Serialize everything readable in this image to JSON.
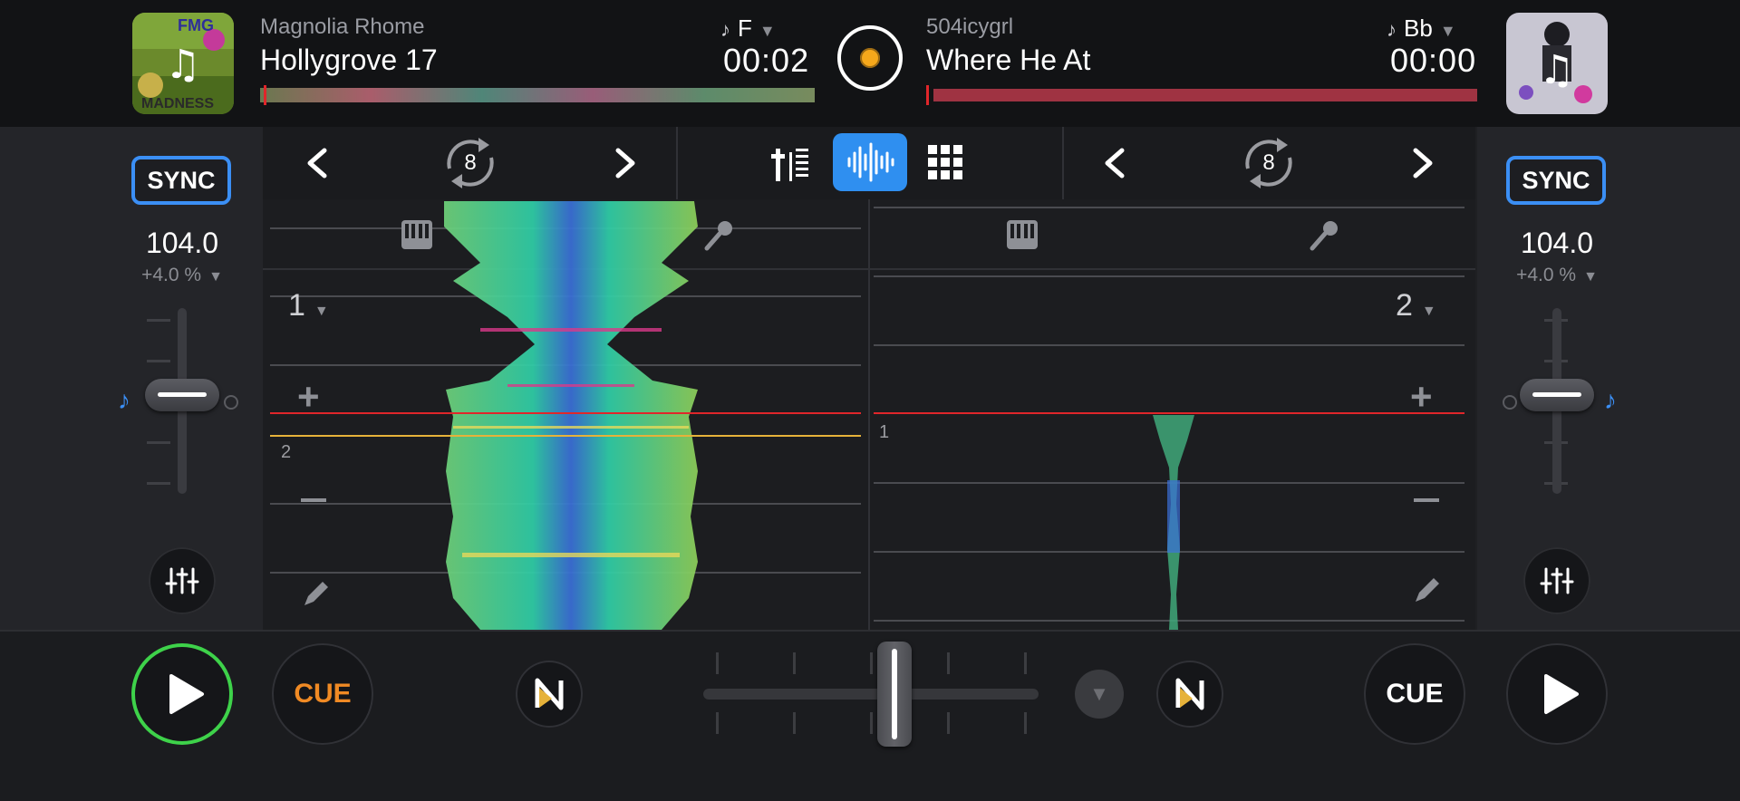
{
  "deck_left": {
    "artist": "Magnolia Rhome",
    "title": "Hollygrove 17",
    "time": "00:02",
    "key": "F",
    "bpm": "104.0",
    "pitch": "+4.0 %",
    "sync_label": "SYNC",
    "cue_label": "CUE",
    "loop_size": "8",
    "hotcue_bank": "1",
    "marker": "2",
    "colors": {
      "cue_text": "#f08a24",
      "play_ring": "#3ed24a"
    }
  },
  "deck_right": {
    "artist": "504icygrl",
    "title": "Where He At",
    "time": "00:00",
    "key": "Bb",
    "bpm": "104.0",
    "pitch": "+4.0 %",
    "sync_label": "SYNC",
    "cue_label": "CUE",
    "loop_size": "8",
    "hotcue_bank": "2",
    "marker": "1"
  },
  "colors": {
    "accent": "#3b8ff5",
    "logo_dot": "#f6a81b",
    "playhead": "#e0262a"
  },
  "icons": {
    "prev": "chevron-left-icon",
    "next": "chevron-right-icon",
    "loop": "loop-icon",
    "mixer": "mixer-view-icon",
    "waveform": "waveform-view-icon",
    "pads": "pads-grid-icon",
    "keys": "piano-icon",
    "vocal": "microphone-icon",
    "eq": "eq-sliders-icon",
    "neural": "neural-mix-icon"
  },
  "crossfader": {
    "position": 0.57
  }
}
